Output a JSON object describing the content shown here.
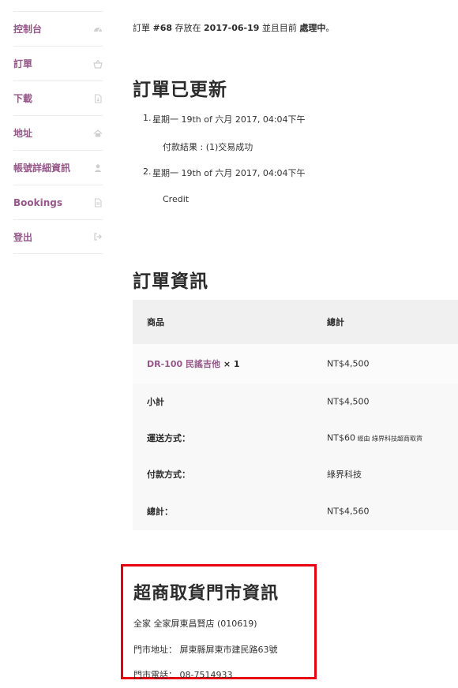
{
  "sidebar": {
    "items": [
      {
        "label": "控制台",
        "icon": "dashboard-icon"
      },
      {
        "label": "訂單",
        "icon": "basket-icon"
      },
      {
        "label": "下載",
        "icon": "file-download-icon"
      },
      {
        "label": "地址",
        "icon": "home-icon"
      },
      {
        "label": "帳號詳細資訊",
        "icon": "user-icon"
      },
      {
        "label": "Bookings",
        "icon": "file-text-icon"
      },
      {
        "label": "登出",
        "icon": "sign-out-icon"
      }
    ]
  },
  "notice": {
    "prefix": "訂單 ",
    "order_no": "#68",
    "mid1": " 存放在 ",
    "date": "2017-06-19",
    "mid2": " 並且目前 ",
    "status": "處理中",
    "suffix": "。"
  },
  "updates": {
    "title": "訂單已更新",
    "notes": [
      {
        "num": "1.",
        "date": "星期一 19th of 六月 2017, 04:04下午",
        "desc": "付款結果 : (1)交易成功"
      },
      {
        "num": "2.",
        "date": "星期一 19th of 六月 2017, 04:04下午",
        "desc": "Credit"
      }
    ]
  },
  "details": {
    "title": "訂單資訊",
    "col_product": "商品",
    "col_total": "總計",
    "item": {
      "name": "DR-100 民謠吉他",
      "qty": "× 1",
      "total": "NT$4,500"
    },
    "rows": [
      {
        "label": "小計",
        "value": "NT$4,500",
        "note": ""
      },
      {
        "label": "運送方式：",
        "value": "NT$60",
        "note": " 經由 綠界科技超商取貨"
      },
      {
        "label": "付款方式：",
        "value": "綠界科技",
        "note": ""
      },
      {
        "label": "總計：",
        "value": "NT$4,560",
        "note": ""
      }
    ]
  },
  "pickup": {
    "title": "超商取貨門市資訊",
    "store": "全家 全家屏東昌賢店 (010619)",
    "address": "門市地址： 屏東縣屏東市建民路63號",
    "phone": "門市電話： 08-7514933"
  },
  "colors": {
    "accent": "#96588a",
    "highlight_border": "#e60012"
  }
}
